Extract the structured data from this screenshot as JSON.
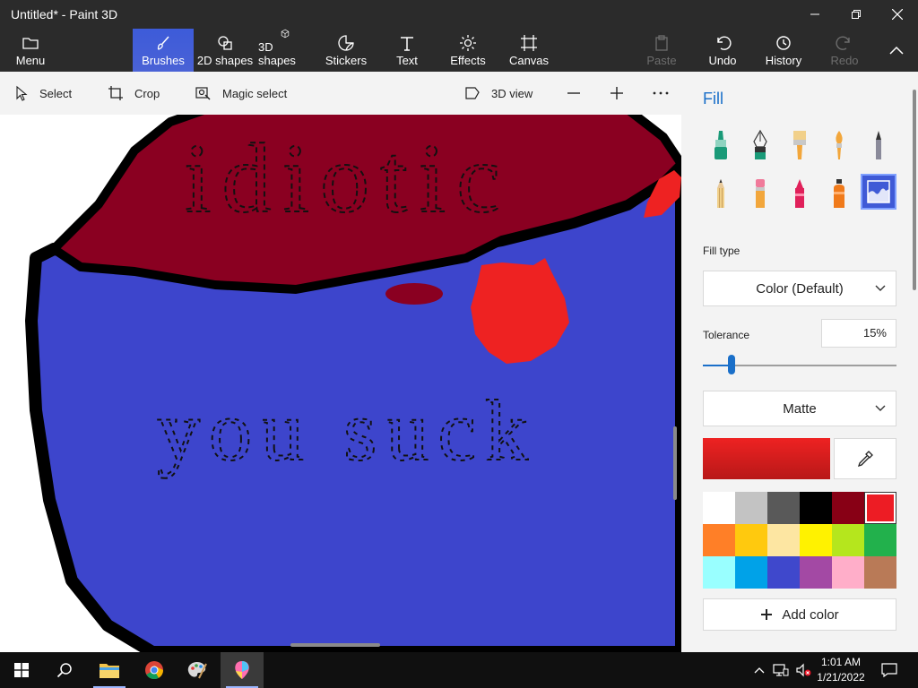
{
  "window": {
    "title": "Untitled* - Paint 3D"
  },
  "ribbon": {
    "menu_label": "Menu",
    "items": [
      {
        "label": "Brushes"
      },
      {
        "label": "2D shapes"
      },
      {
        "label": "3D shapes"
      },
      {
        "label": "Stickers"
      },
      {
        "label": "Text"
      },
      {
        "label": "Effects"
      },
      {
        "label": "Canvas"
      }
    ],
    "paste_label": "Paste",
    "undo_label": "Undo",
    "history_label": "History",
    "redo_label": "Redo"
  },
  "toolbar": {
    "select_label": "Select",
    "crop_label": "Crop",
    "magic_select_label": "Magic select",
    "view_3d_label": "3D view"
  },
  "canvas": {
    "drawn_text_top": "idiotic",
    "drawn_text_bottom": "you suck",
    "colors": {
      "maroon": "#8a0021",
      "blue": "#3d45cc",
      "red": "#ee2222",
      "outline": "#000000"
    }
  },
  "panel": {
    "title": "Fill",
    "brushes": [
      "marker-icon",
      "calligraphy-pen-icon",
      "oil-brush-icon",
      "watercolor-icon",
      "pixel-pen-icon",
      "pencil-icon",
      "eraser-icon",
      "crayon-icon",
      "spray-can-icon",
      "fill-bucket-icon"
    ],
    "selected_brush_index": 9,
    "fill_type_label": "Fill type",
    "fill_type_value": "Color (Default)",
    "tolerance_label": "Tolerance",
    "tolerance_value": "15%",
    "tolerance_fraction": 0.15,
    "finish_value": "Matte",
    "current_color": "#ee2222",
    "palette": [
      "#ffffff",
      "#c3c3c3",
      "#595959",
      "#000000",
      "#880015",
      "#ed1c24",
      "#ff7f27",
      "#ffc90e",
      "#fde6a2",
      "#fff200",
      "#b5e61d",
      "#22b14c",
      "#99ffff",
      "#00a2e8",
      "#3f48cc",
      "#a349a4",
      "#ffaec9",
      "#b97a57"
    ],
    "selected_palette_index": 5,
    "add_color_label": "Add color"
  },
  "taskbar": {
    "time": "1:01 AM",
    "date": "1/21/2022"
  }
}
